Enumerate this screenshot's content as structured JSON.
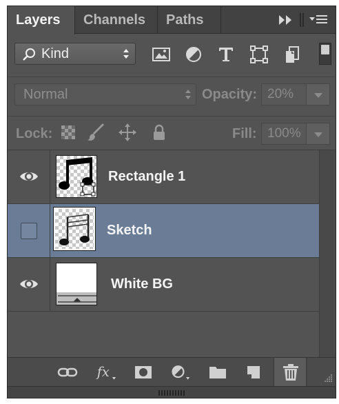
{
  "tabs": [
    {
      "label": "Layers",
      "active": true
    },
    {
      "label": "Channels",
      "active": false
    },
    {
      "label": "Paths",
      "active": false
    }
  ],
  "filter": {
    "kind_label": "Kind",
    "filter_icons": [
      "image-filter-icon",
      "adjustment-filter-icon",
      "type-filter-icon",
      "shape-filter-icon",
      "smart-object-filter-icon"
    ],
    "filter_toggle_on": true
  },
  "blend": {
    "mode": "Normal",
    "opacity_label": "Opacity:",
    "opacity_value": "20%"
  },
  "lock": {
    "label": "Lock:",
    "icons": [
      "lock-transparent-icon",
      "lock-image-icon",
      "lock-position-icon",
      "lock-all-icon"
    ],
    "fill_label": "Fill:",
    "fill_value": "100%"
  },
  "layers": [
    {
      "name": "Rectangle 1",
      "visible": true,
      "selected": false,
      "type": "shape"
    },
    {
      "name": "Sketch",
      "visible": false,
      "selected": true,
      "type": "pixel"
    },
    {
      "name": "White BG",
      "visible": true,
      "selected": false,
      "type": "fill"
    }
  ],
  "bottom_icons": [
    "link-layers-icon",
    "fx-icon",
    "add-mask-icon",
    "adjustment-layer-icon",
    "new-group-icon",
    "new-layer-icon",
    "delete-layer-icon"
  ],
  "colors": {
    "panel_bg": "#535353",
    "selected_row": "#6a7c96",
    "tab_bar": "#424242"
  }
}
